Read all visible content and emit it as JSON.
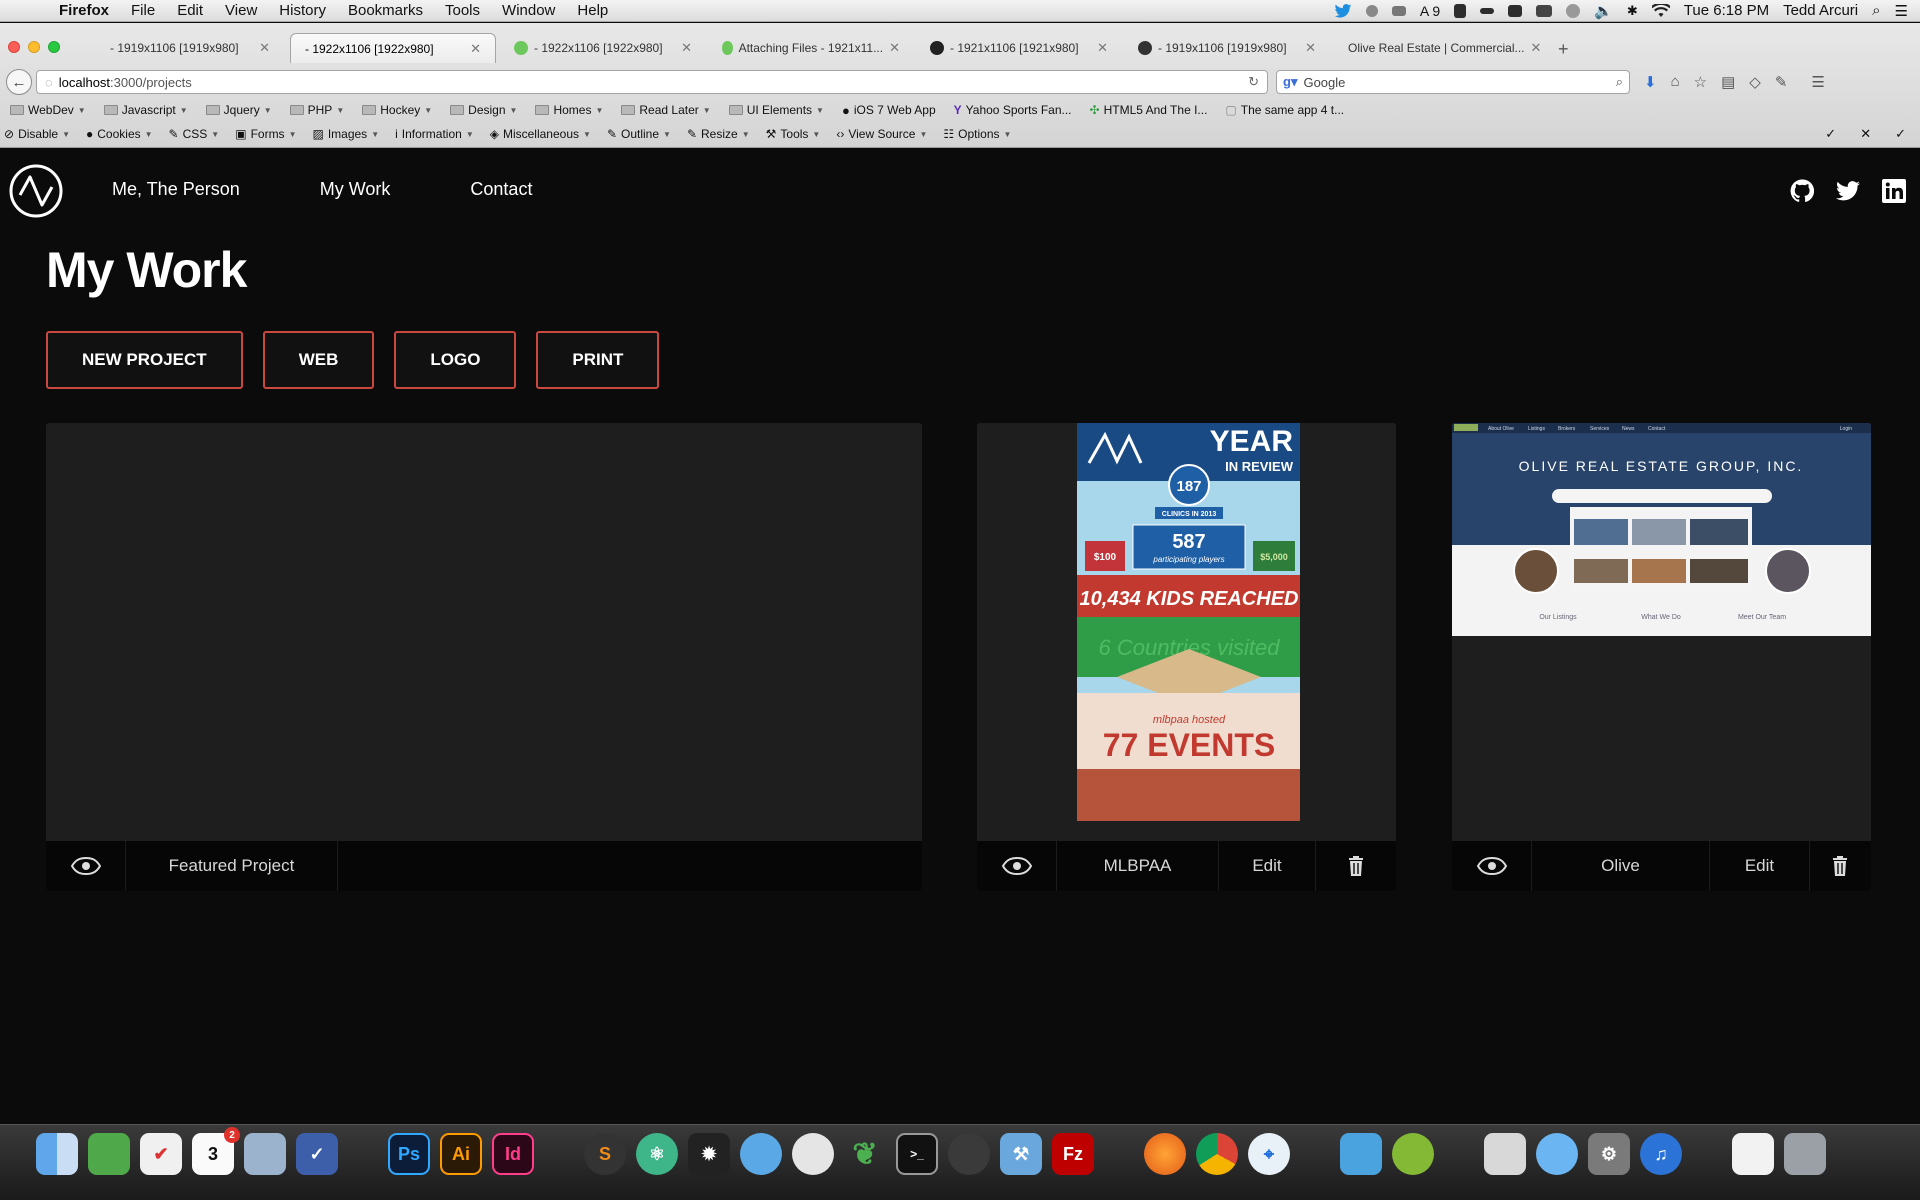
{
  "menubar": {
    "app": "Firefox",
    "items": [
      "File",
      "Edit",
      "View",
      "History",
      "Bookmarks",
      "Tools",
      "Window",
      "Help"
    ],
    "status_count": "9",
    "clock": "Tue 6:18 PM",
    "user": "Tedd Arcuri"
  },
  "tabs": [
    {
      "title": "- 1919x1106 [1919x980]"
    },
    {
      "title": "- 1922x1106 [1922x980]"
    },
    {
      "title": "- 1922x1106 [1922x980]"
    },
    {
      "title": "Attaching Files - 1921x11..."
    },
    {
      "title": "- 1921x1106 [1921x980]"
    },
    {
      "title": "- 1919x1106 [1919x980]"
    },
    {
      "title": "Olive Real Estate | Commercial..."
    }
  ],
  "url": {
    "host": "localhost",
    "path": ":3000/projects"
  },
  "search": {
    "placeholder": "Google"
  },
  "bookmarks": [
    "WebDev",
    "Javascript",
    "Jquery",
    "PHP",
    "Hockey",
    "Design",
    "Homes",
    "Read Later",
    "UI Elements",
    "iOS 7 Web App",
    "Yahoo Sports Fan...",
    "HTML5 And The I...",
    "The same app 4 t..."
  ],
  "devbar": [
    "Disable",
    "Cookies",
    "CSS",
    "Forms",
    "Images",
    "Information",
    "Miscellaneous",
    "Outline",
    "Resize",
    "Tools",
    "View Source",
    "Options"
  ],
  "site": {
    "nav": [
      "Me, The Person",
      "My Work",
      "Contact"
    ],
    "title": "My Work",
    "filters": [
      "NEW PROJECT",
      "WEB",
      "LOGO",
      "PRINT"
    ],
    "cards": [
      {
        "label": "Featured Project"
      },
      {
        "label": "MLBPAA",
        "edit": "Edit"
      },
      {
        "label": "Olive",
        "edit": "Edit"
      }
    ],
    "poster": {
      "year": "YEAR",
      "in_review": "IN REVIEW",
      "clinics": "187",
      "clinics_label": "CLINICS IN 2013",
      "players": "587",
      "players_label": "participating players",
      "kids": "10,434 KIDS REACHED",
      "countries": "6 Countries visited",
      "hosted": "mlbpaa hosted",
      "events": "77 EVENTS",
      "amount": "$100",
      "amount2": "$5,000"
    },
    "olive": {
      "heading": "OLIVE REAL ESTATE GROUP, INC.",
      "nav": [
        "About Olive",
        "Listings",
        "Brokers",
        "Services",
        "News",
        "Contact"
      ],
      "login": "Login",
      "col1": "Our Listings",
      "col2": "What We Do",
      "col3": "Meet Our Team"
    }
  },
  "dock": {
    "calendar_day": "3",
    "badge": "2"
  }
}
